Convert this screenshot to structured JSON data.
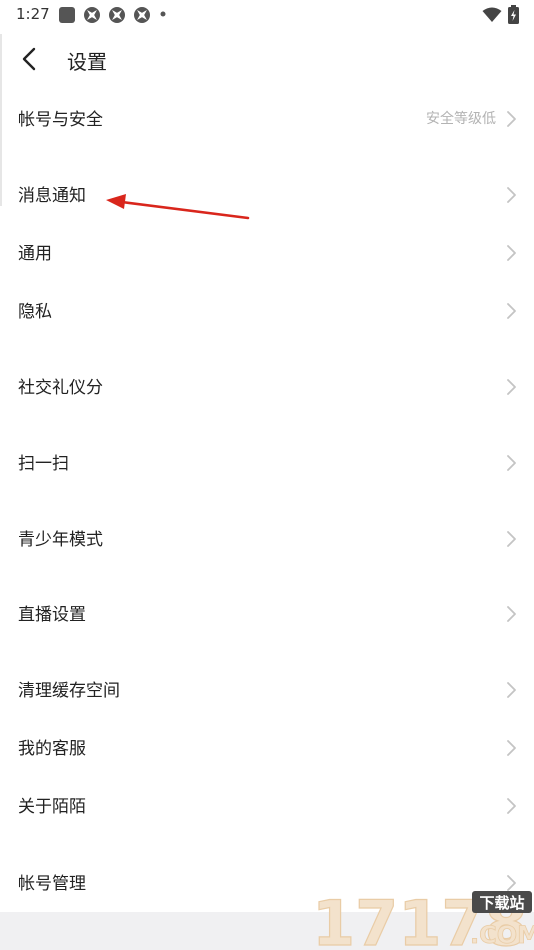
{
  "status_bar": {
    "time": "1:27"
  },
  "header": {
    "title": "设置"
  },
  "rows": [
    {
      "label": "帐号与安全",
      "value": "安全等级低"
    },
    {
      "label": "消息通知",
      "value": ""
    },
    {
      "label": "通用",
      "value": ""
    },
    {
      "label": "隐私",
      "value": ""
    },
    {
      "label": "社交礼仪分",
      "value": ""
    },
    {
      "label": "扫一扫",
      "value": ""
    },
    {
      "label": "青少年模式",
      "value": ""
    },
    {
      "label": "直播设置",
      "value": ""
    },
    {
      "label": "清理缓存空间",
      "value": ""
    },
    {
      "label": "我的客服",
      "value": ""
    },
    {
      "label": "关于陌陌",
      "value": ""
    },
    {
      "label": "帐号管理",
      "value": ""
    }
  ],
  "watermark": {
    "number": "17178",
    "tag": "下载站",
    "domain": ".COM"
  },
  "colors": {
    "text": "#222222",
    "secondary_text": "#b3b3b3",
    "chevron": "#c4c4c4",
    "annotation_arrow": "#d9261c",
    "bottom_band": "#f0f0f2"
  },
  "icons": [
    "stop-square-icon",
    "flower-icon",
    "flower-icon",
    "flower-icon",
    "dot-icon",
    "wifi-icon",
    "battery-icon",
    "back-arrow-icon",
    "chevron-right-icon"
  ]
}
